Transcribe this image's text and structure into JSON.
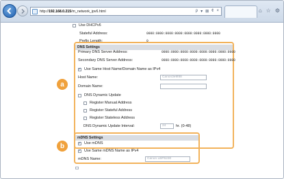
{
  "browser": {
    "url_prefix": "http://",
    "url_host": "192.168.0.215",
    "url_path": "/m_network_ipv6.html",
    "addr_tools": [
      "ρ",
      "▾",
      "⊠",
      "¢",
      "×"
    ],
    "win_icons": [
      "⌂",
      "☆",
      "⚙"
    ]
  },
  "top_section": {
    "use_dhcpv6_label": "Use DHCPv6",
    "stateful_address_label": "Stateful Address:",
    "stateful_address_value": "0000:0000:0000:0000:0000:0000:0000:0000",
    "prefix_length_label": "Prefix Length:",
    "prefix_length_value": "0"
  },
  "dns": {
    "title": "DNS Settings",
    "primary_label": "Primary DNS Server Address:",
    "primary_value": "0000:0000:0000:0000:0000:0000:0000:0000",
    "secondary_label": "Secondary DNS Server Address:",
    "secondary_value": "0000:0000:0000:0000:0000:0000:0000:0000",
    "use_same_label": "Use Same Host Name/Domain Name as IPv4",
    "host_name_label": "Host Name:",
    "host_name_placeholder": "Canon3e9f88",
    "domain_name_label": "Domain Name:",
    "dynamic_update_label": "DNS Dynamic Update",
    "register_manual_label": "Register Manual Address",
    "register_stateful_label": "Register Stateful Address",
    "register_stateless_label": "Register Stateless Address",
    "interval_label": "DNS Dynamic Update Interval:",
    "interval_value": "24",
    "interval_hint": "hr. (0-48)"
  },
  "mdns": {
    "title": "mDNS Settings",
    "use_mdns_label": "Use mDNS",
    "use_same_label": "Use Same mDNS Name as IPv4",
    "mdns_name_label": "mDNS Name:",
    "mdns_name_placeholder": "Canon LBP6230"
  },
  "callouts": {
    "a": "a",
    "b": "b"
  }
}
